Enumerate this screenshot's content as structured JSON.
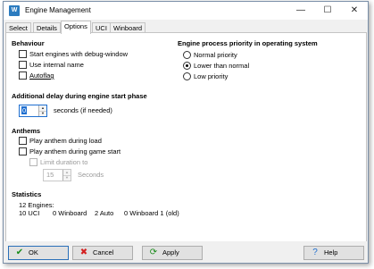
{
  "window": {
    "title": "Engine Management",
    "app_icon": "W"
  },
  "title_controls": {
    "minimize": "—",
    "maximize": "☐",
    "close": "✕"
  },
  "tabs": [
    "Select",
    "Details",
    "Options",
    "UCI",
    "Winboard"
  ],
  "active_tab": "Options",
  "behaviour": {
    "heading": "Behaviour",
    "options": [
      {
        "label": "Start engines with debug-window",
        "checked": false
      },
      {
        "label": "Use internal name",
        "checked": false
      },
      {
        "label": "Autoflag",
        "checked": false
      }
    ]
  },
  "priority": {
    "heading": "Engine process priority in operating system",
    "options": [
      "Normal priority",
      "Lower than normal",
      "Low priority"
    ],
    "selected": "Lower than normal"
  },
  "delay": {
    "heading": "Additional delay during engine start phase",
    "value": "0",
    "suffix": "seconds (if needed)"
  },
  "anthems": {
    "heading": "Anthems",
    "during_load": "Play anthem during load",
    "game_start": "Play anthem during game start",
    "limit_duration": "Limit duration to",
    "duration_value": "15",
    "duration_unit": "Seconds"
  },
  "statistics": {
    "heading": "Statistics",
    "total": "12 Engines:",
    "breakdown": [
      "10 UCI",
      "0 Winboard",
      "2 Auto",
      "0 Winboard 1 (old)"
    ]
  },
  "buttons": {
    "ok": "OK",
    "cancel": "Cancel",
    "apply": "Apply",
    "help": "Help"
  },
  "colors": {
    "ok_icon": "#1a8c1a",
    "cancel_icon": "#d42020",
    "apply_icon": "#1a8c1a",
    "help_icon": "#1f6fd0"
  }
}
